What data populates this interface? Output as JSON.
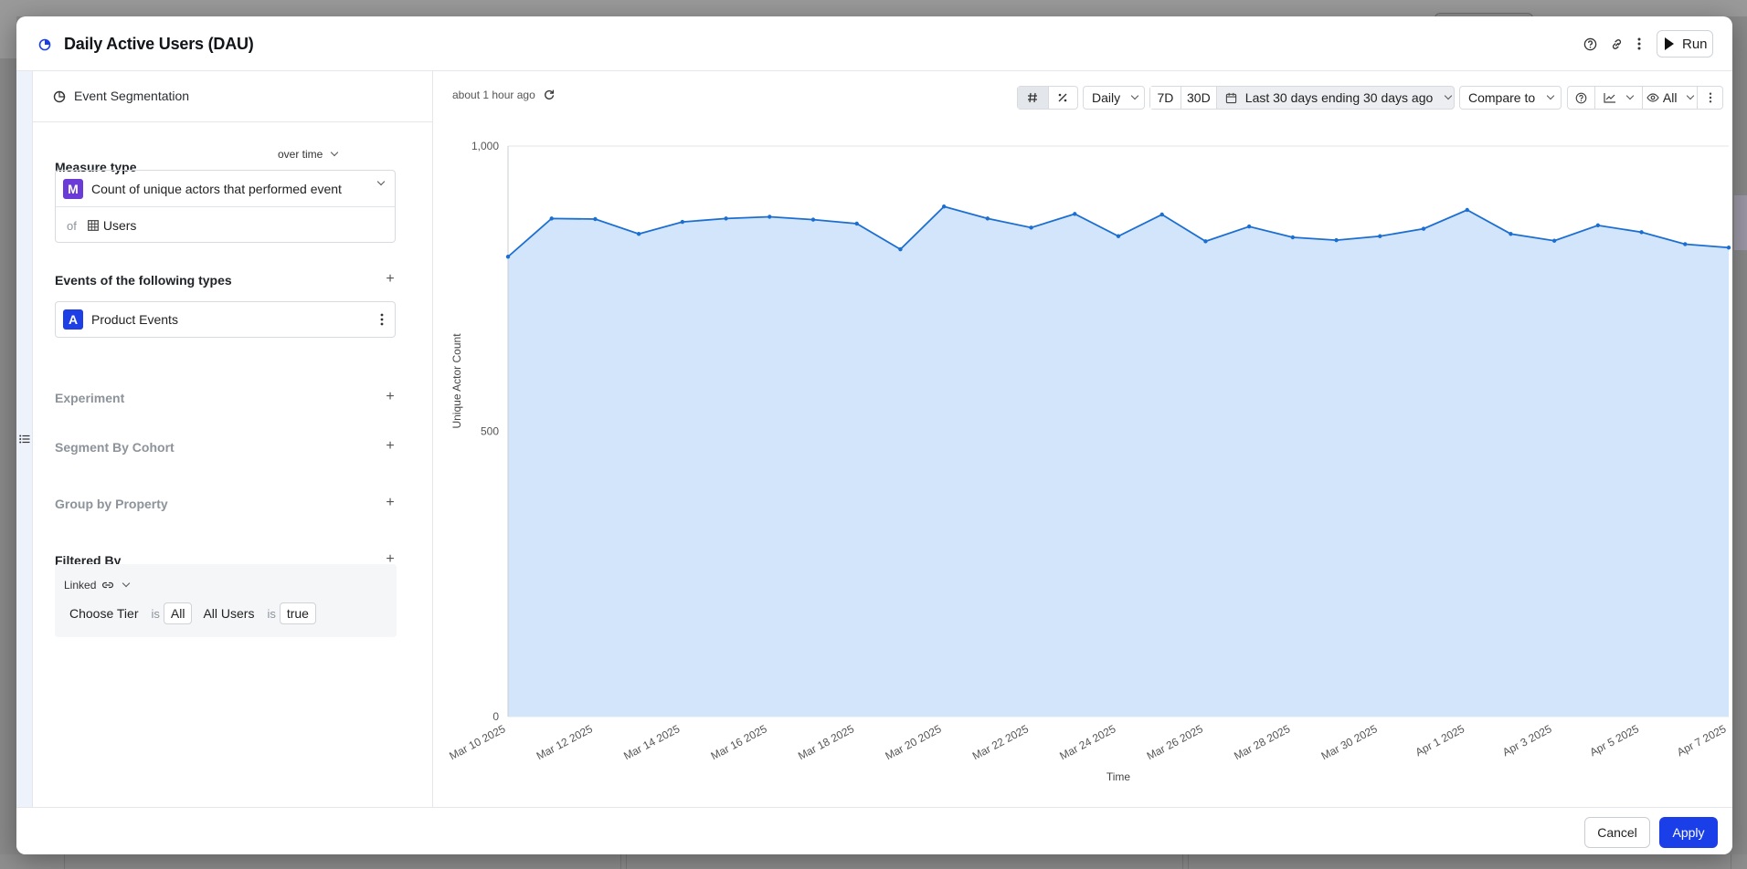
{
  "modal": {
    "title": "Daily Active Users (DAU)",
    "run_label": "Run",
    "cancel_label": "Cancel",
    "apply_label": "Apply"
  },
  "query": {
    "mode_label": "Event Segmentation",
    "measure_type_label": "Measure type",
    "measure_mode": "over time",
    "measure_badge": "M",
    "measure_value": "Count of unique actors that performed event",
    "of_label": "of",
    "of_value": "Users",
    "events_label": "Events of the following types",
    "event_badge": "A",
    "event_value": "Product Events",
    "experiment_label": "Experiment",
    "cohort_label": "Segment By Cohort",
    "group_label": "Group by Property",
    "filtered_label": "Filtered By",
    "linked_label": "Linked",
    "filters": [
      {
        "name": "Choose Tier",
        "op": "is",
        "value": "All"
      },
      {
        "name": "All Users",
        "op": "is",
        "value": "true"
      }
    ]
  },
  "toolbar": {
    "updated": "about 1 hour ago",
    "granularity": "Daily",
    "range_7d": "7D",
    "range_30d": "30D",
    "date_range": "Last 30 days ending 30 days ago",
    "compare": "Compare to",
    "visibility": "All"
  },
  "chart_data": {
    "type": "area",
    "xlabel": "Time",
    "ylabel": "Unique Actor Count",
    "ylim": [
      0,
      1000
    ],
    "yticks": [
      0,
      500,
      1000
    ],
    "ytick_labels": [
      "0",
      "500",
      "1,000"
    ],
    "xtick_labels": [
      "Mar 10 2025",
      "Mar 12 2025",
      "Mar 14 2025",
      "Mar 16 2025",
      "Mar 18 2025",
      "Mar 20 2025",
      "Mar 22 2025",
      "Mar 24 2025",
      "Mar 26 2025",
      "Mar 28 2025",
      "Mar 30 2025",
      "Apr 1 2025",
      "Apr 3 2025",
      "Apr 5 2025",
      "Apr 7 2025"
    ],
    "x": [
      "Mar 10 2025",
      "Mar 11 2025",
      "Mar 12 2025",
      "Mar 13 2025",
      "Mar 14 2025",
      "Mar 15 2025",
      "Mar 16 2025",
      "Mar 17 2025",
      "Mar 18 2025",
      "Mar 19 2025",
      "Mar 20 2025",
      "Mar 21 2025",
      "Mar 22 2025",
      "Mar 23 2025",
      "Mar 24 2025",
      "Mar 25 2025",
      "Mar 26 2025",
      "Mar 27 2025",
      "Mar 28 2025",
      "Mar 29 2025",
      "Mar 30 2025",
      "Mar 31 2025",
      "Apr 1 2025",
      "Apr 2 2025",
      "Apr 3 2025",
      "Apr 4 2025",
      "Apr 5 2025",
      "Apr 6 2025",
      "Apr 7 2025"
    ],
    "values": [
      806,
      873,
      872,
      846,
      867,
      873,
      876,
      871,
      864,
      819,
      894,
      873,
      857,
      881,
      842,
      880,
      833,
      859,
      840,
      835,
      842,
      855,
      888,
      846,
      834,
      861,
      849,
      828,
      822
    ],
    "grid": true,
    "colors": {
      "line": "#1c6fd1",
      "fill": "#d2e5fa",
      "grid": "#e2e4e8"
    }
  }
}
